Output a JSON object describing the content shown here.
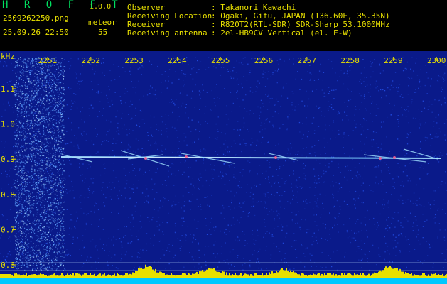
{
  "header": {
    "app_title": "H R O F F T",
    "version": "1.0.0",
    "filename": "2509262250.png",
    "detection_label": "meteor",
    "datetime": "25.09.26 22:50",
    "detection_count": "55",
    "info": [
      {
        "label": "Observer",
        "value": ": Takanori Kawachi"
      },
      {
        "label": "Receiving Location",
        "value": ": Ogaki, Gifu, JAPAN (136.60E, 35.35N)"
      },
      {
        "label": "Receiver",
        "value": ": R820T2(RTL-SDR) SDR-Sharp 53.1000MHz"
      },
      {
        "label": "Receiving antenna",
        "value": ": 2el-HB9CV Vertical (el. E-W)"
      }
    ]
  },
  "spectrogram": {
    "y_unit": "kHz",
    "time_ticks": [
      "2251",
      "2252",
      "2253",
      "2254",
      "2255",
      "2256",
      "2257",
      "2258",
      "2259",
      "2300"
    ],
    "freq_ticks": [
      "1.1",
      "1.0",
      "0.9",
      "0.8",
      "0.7",
      "0.6"
    ],
    "colors": {
      "background": "#0a1a8a",
      "noise": "#2a5cff",
      "echo": "#ffffff",
      "level_bar": "#e8e000",
      "base_bar": "#00c8ff",
      "text": "#e8e000"
    }
  }
}
